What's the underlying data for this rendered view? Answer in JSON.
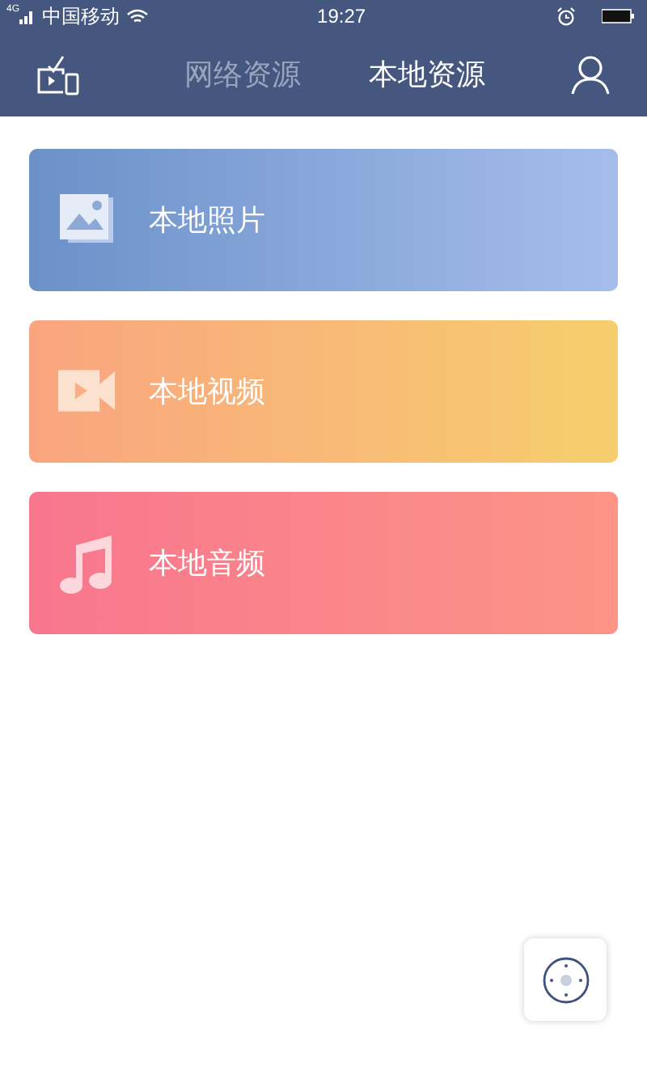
{
  "status_bar": {
    "network": "4G",
    "carrier": "中国移动",
    "time": "19:27"
  },
  "tabs": [
    {
      "label": "网络资源",
      "selected": false
    },
    {
      "label": "本地资源",
      "selected": true
    }
  ],
  "cards": [
    {
      "kind": "photo",
      "label": "本地照片"
    },
    {
      "kind": "video",
      "label": "本地视频"
    },
    {
      "kind": "audio",
      "label": "本地音频"
    }
  ]
}
